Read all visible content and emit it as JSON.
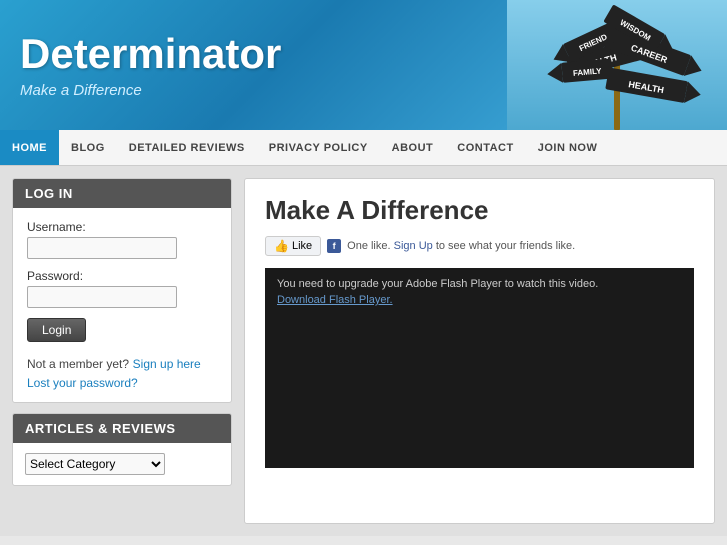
{
  "header": {
    "site_title": "Determinator",
    "tagline": "Make a Difference"
  },
  "nav": {
    "items": [
      {
        "label": "HOME",
        "active": true
      },
      {
        "label": "BLOG",
        "active": false
      },
      {
        "label": "DETAILED REVIEWS",
        "active": false
      },
      {
        "label": "PRIVACY POLICY",
        "active": false
      },
      {
        "label": "ABOUT",
        "active": false
      },
      {
        "label": "CONTACT",
        "active": false
      },
      {
        "label": "JOIN NOW",
        "active": false
      }
    ]
  },
  "sidebar": {
    "login_widget": {
      "title": "LOG IN",
      "username_label": "Username:",
      "password_label": "Password:",
      "login_button": "Login",
      "not_member_text": "Not a member yet?",
      "signup_link": "Sign up here",
      "forgot_link": "Lost your password?"
    },
    "articles_widget": {
      "title": "ARTICLES & REVIEWS",
      "select_placeholder": "Select Category"
    }
  },
  "content": {
    "title": "Make A Difference",
    "like_button": "Like",
    "like_info": "One like.",
    "like_signup": "Sign Up",
    "like_suffix": "to see what your friends like.",
    "video_text": "You need to upgrade your Adobe Flash Player to watch this video.",
    "video_link": "Download Flash Player.",
    "video_link_url": "#"
  },
  "signpost": {
    "labels": [
      "FRIEND",
      "WISDOM",
      "WEALTH",
      "CAREER",
      "FAMILY",
      "HEALTH"
    ]
  }
}
